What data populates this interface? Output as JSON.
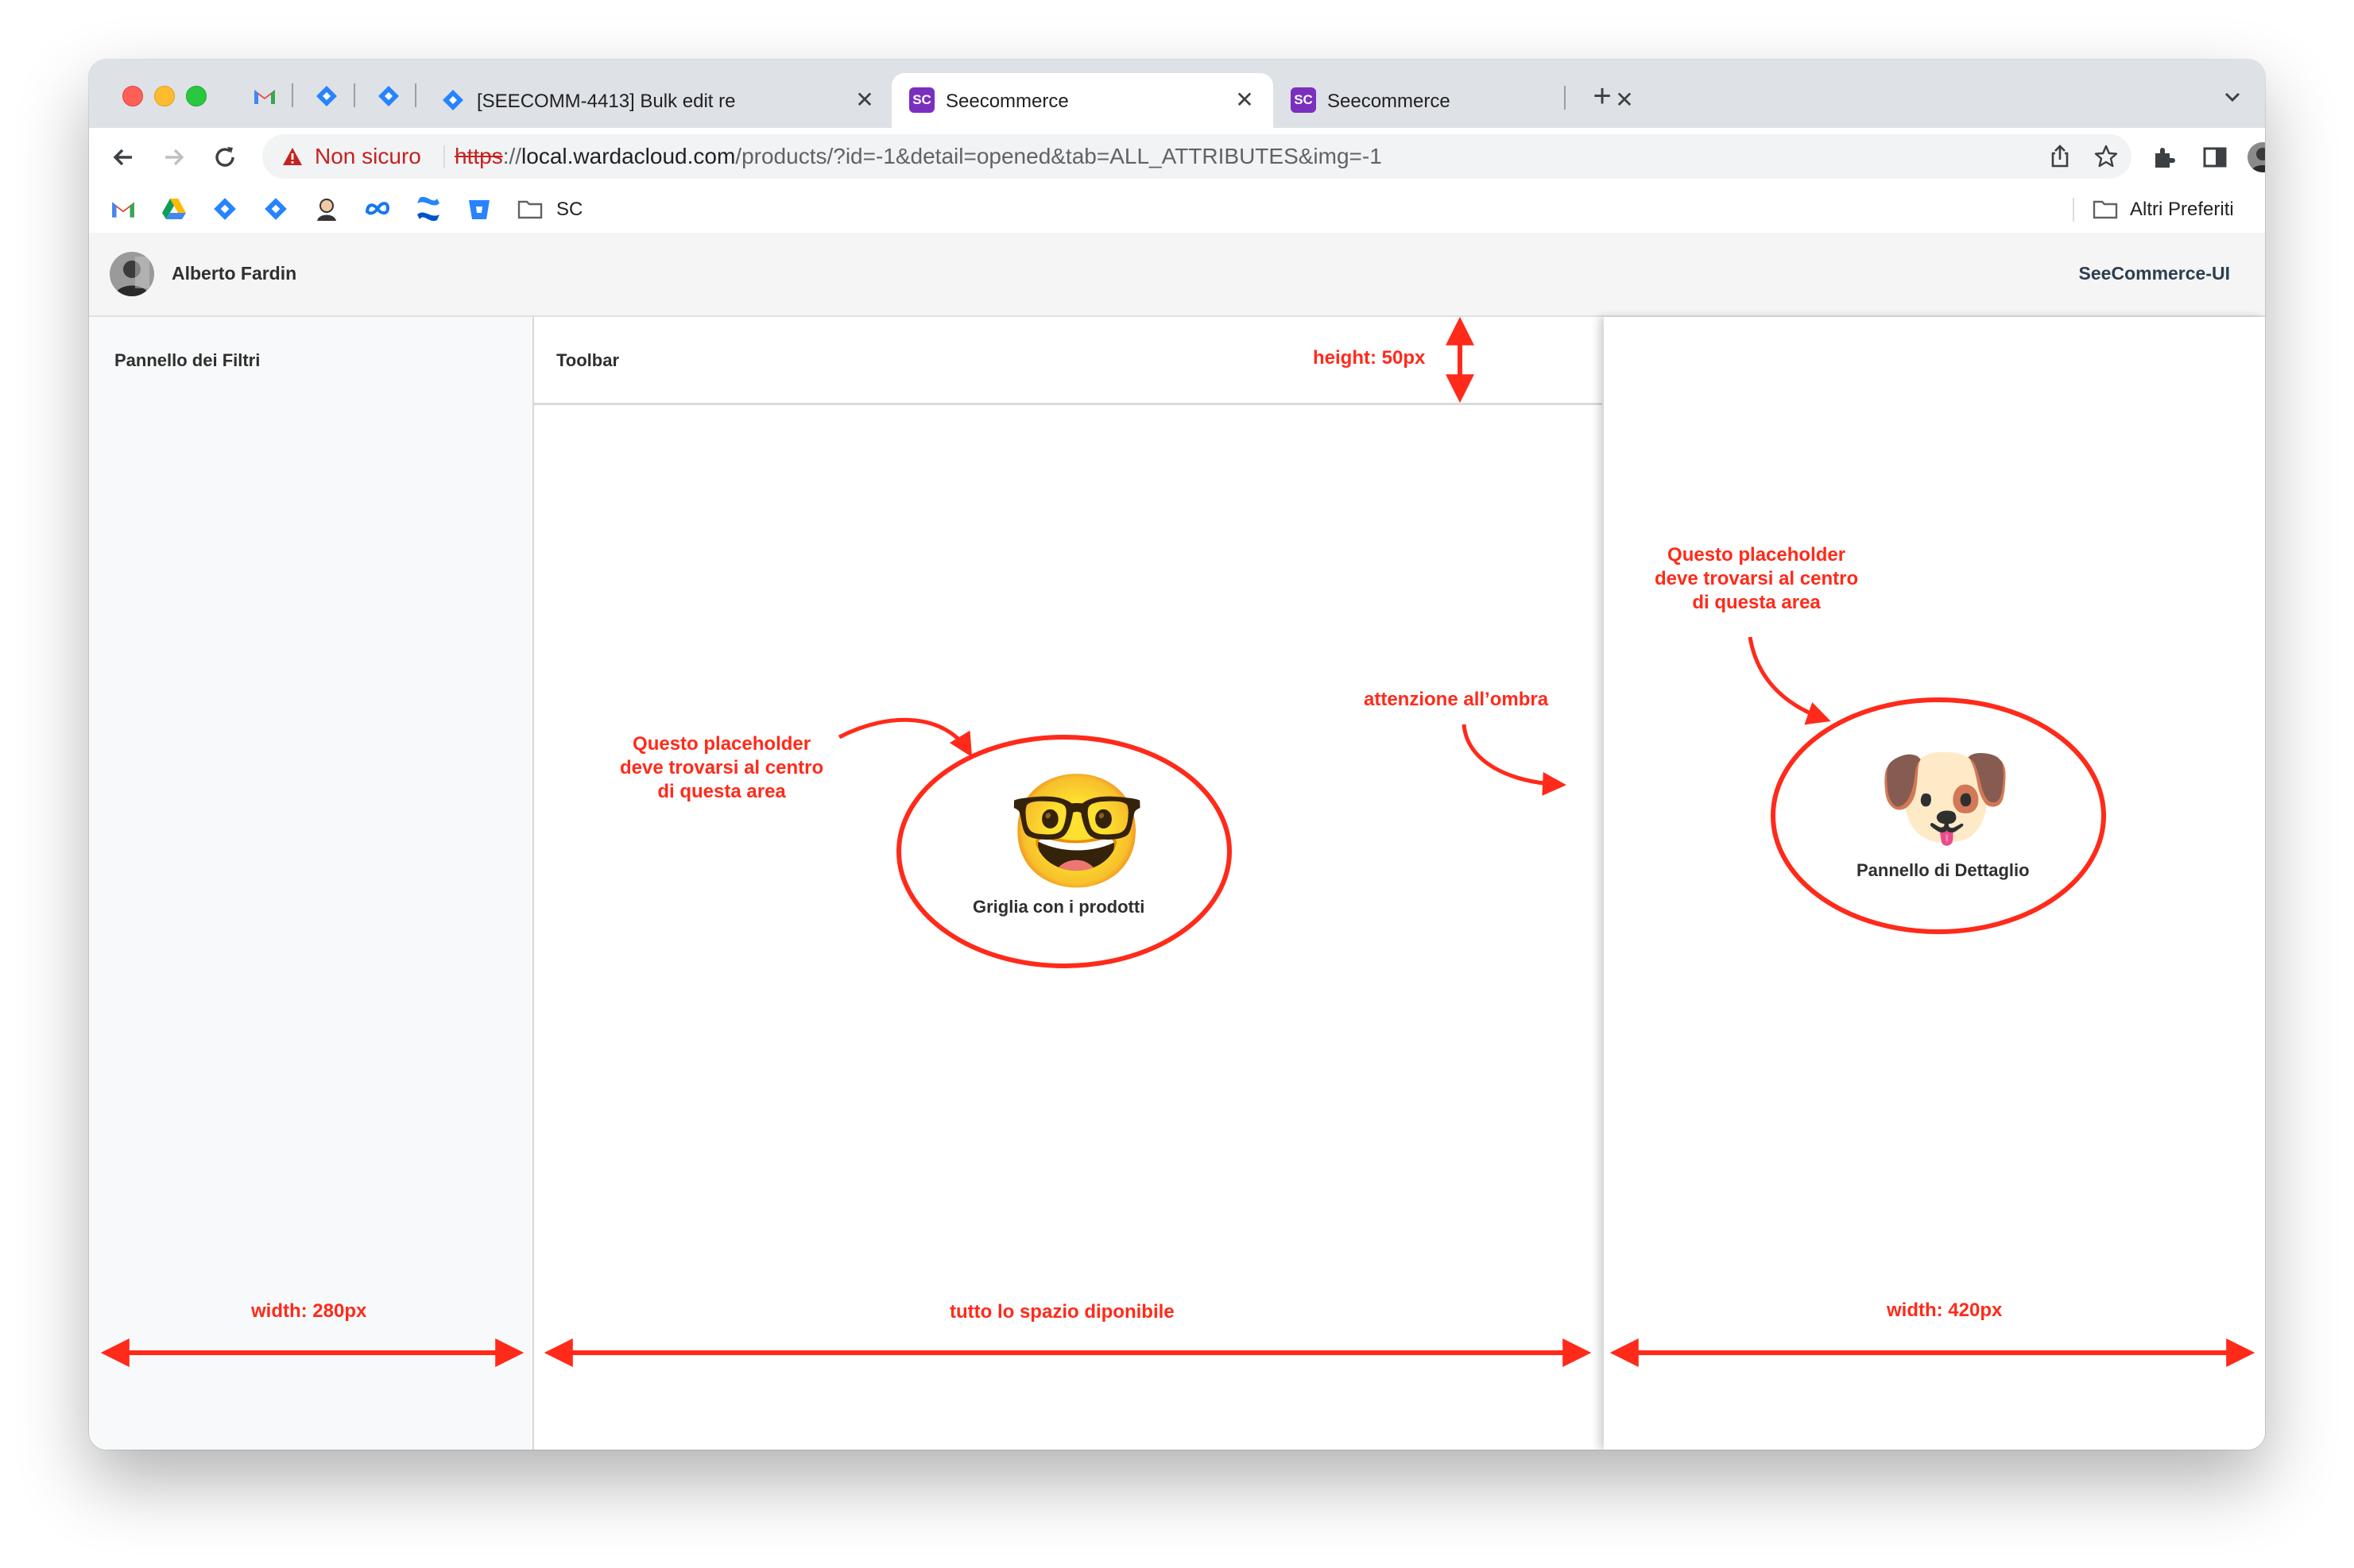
{
  "browser": {
    "tabs": [
      {
        "title": "[SEECOMM-4413] Bulk edit re",
        "active": false
      },
      {
        "title": "Seecommerce",
        "active": true
      },
      {
        "title": "Seecommerce",
        "active": false
      }
    ],
    "pinned_icons": [
      "gmail-icon",
      "jira-icon",
      "jira-icon"
    ],
    "new_tab": "+",
    "close_glyph": "✕",
    "favicon_text": "SC",
    "security_label": "Non sicuro",
    "url": {
      "protocol": "https",
      "sep": "://",
      "host": "local.wardacloud.com",
      "path": "/products/?id=-1&detail=opened&tab=ALL_ATTRIBUTES&img=-1"
    },
    "bookmarks": {
      "icons": [
        "gmail-icon",
        "drive-icon",
        "jira-icon",
        "jira-icon",
        "avatar-icon",
        "meta-icon",
        "confluence-icon",
        "bitbucket-icon"
      ],
      "folder_label": "SC",
      "other_label": "Altri Preferiti"
    }
  },
  "app": {
    "user_name": "Alberto Fardin",
    "app_name": "SeeCommerce-UI",
    "filters_label": "Pannello dei Filtri",
    "toolbar_label": "Toolbar",
    "grid_placeholder": {
      "emoji": "🤓",
      "label": "Griglia con i prodotti"
    },
    "detail_placeholder": {
      "emoji": "🐶",
      "label": "Pannello di Dettaglio"
    }
  },
  "annotations": {
    "toolbar_height": "height: 50px",
    "shadow_note": "attenzione all’ombra",
    "center_note_lines": [
      "Questo placeholder",
      "deve trovarsi al centro",
      "di questa area"
    ],
    "filters_width": "width: 280px",
    "center_width": "tutto lo spazio diponibile",
    "detail_width": "width: 420px",
    "color": "#ff2a1a"
  }
}
